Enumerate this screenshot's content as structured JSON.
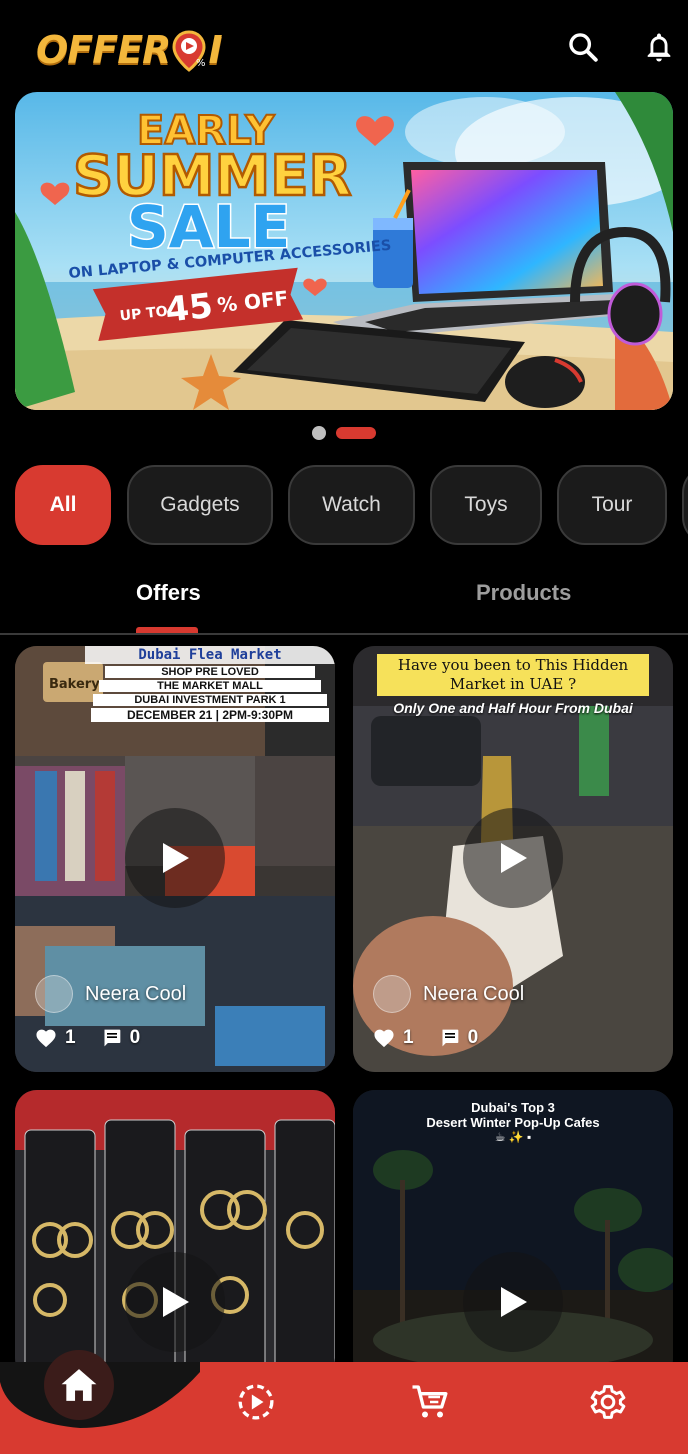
{
  "app": {
    "logo_text_left": "OFFER",
    "logo_text_right": "I"
  },
  "header": {
    "search_icon": "search-icon",
    "bell_icon": "bell-icon"
  },
  "banner": {
    "line1": "EARLY",
    "line2": "SUMMER",
    "line3": "SALE",
    "subtitle": "ON LAPTOP & COMPUTER ACCESSORIES",
    "offer_prefix": "UP TO",
    "offer_value": "45",
    "offer_suffix": "% OFF"
  },
  "carousel": {
    "count": 2,
    "active": 1
  },
  "categories": [
    "All",
    "Gadgets",
    "Watch",
    "Toys",
    "Tour"
  ],
  "tabs": [
    "Offers",
    "Products"
  ],
  "cards": [
    {
      "caption_title": "Dubai Flea Market",
      "caption_lines": [
        "SHOP PRE LOVED",
        "THE MARKET MALL",
        "DUBAI INVESTMENT PARK 1",
        "DECEMBER 21 | 2PM-9:30PM"
      ],
      "shop_sign": "Bakery",
      "user": "Neera Cool",
      "likes": "1",
      "comments": "0"
    },
    {
      "caption_title": "Have you been to This Hidden Market in UAE ?",
      "caption_sub": "Only One and Half Hour From Dubai",
      "user": "Neera Cool",
      "likes": "1",
      "comments": "0"
    },
    {},
    {
      "caption_title": "Dubai's Top 3",
      "caption_sub": "Desert Winter Pop-Up Cafes"
    }
  ],
  "bottom_nav": {
    "items": [
      "home-icon",
      "play-circle-icon",
      "cart-icon",
      "settings-icon"
    ],
    "active": 0
  },
  "colors": {
    "accent": "#d83a30",
    "logo": "#f3b73c",
    "chip_bg": "#1b1b1b"
  }
}
